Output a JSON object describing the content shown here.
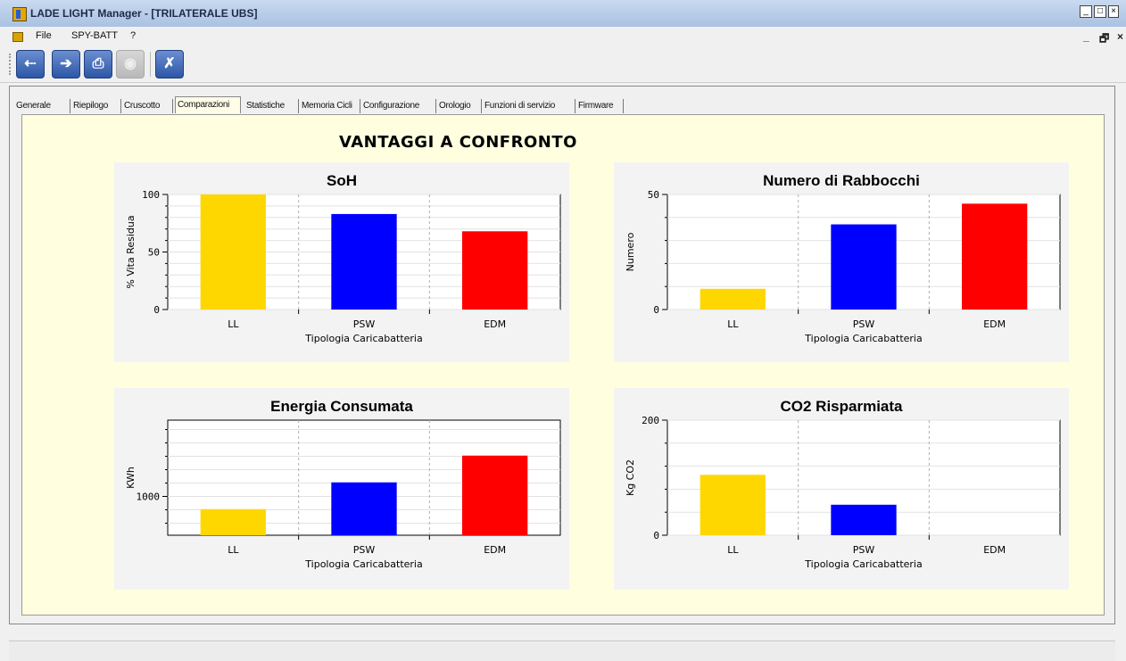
{
  "window": {
    "title": "LADE LIGHT Manager - [TRILATERALE UBS]",
    "controls": [
      "_",
      "□",
      "×"
    ],
    "mdi_controls": [
      "_",
      "🗗",
      "×"
    ]
  },
  "menu": {
    "items": [
      "File",
      "SPY-BATT",
      "?"
    ]
  },
  "toolbar": {
    "buttons": [
      {
        "icon": "usb-icon",
        "glyph": "⇠"
      },
      {
        "icon": "export-icon",
        "glyph": "➔"
      },
      {
        "icon": "print-icon",
        "glyph": "⎙"
      },
      {
        "icon": "disabled-circle-icon",
        "glyph": "◉"
      },
      {
        "icon": "close-x-icon",
        "glyph": "✗"
      }
    ]
  },
  "tabs": [
    "Generale",
    "Riepilogo",
    "Cruscotto",
    "Comparazioni",
    "Statistiche",
    "Memoria Cicli",
    "Configurazione",
    "Orologio",
    "Funzioni di servizio",
    "Firmware"
  ],
  "active_tab": "Comparazioni",
  "page": {
    "title": "VANTAGGI A CONFRONTO"
  },
  "colors": {
    "LL": "#ffd700",
    "PSW": "#0000ff",
    "EDM": "#ff0000"
  },
  "chart_data": [
    {
      "type": "bar",
      "title": "SoH",
      "xlabel": "Tipologia Caricabatteria",
      "ylabel": "% Vita Residua",
      "categories": [
        "LL",
        "PSW",
        "EDM"
      ],
      "values": [
        100,
        83,
        68
      ],
      "ylim": [
        0,
        100
      ],
      "yticks": [
        0,
        50,
        100
      ],
      "minor_step": 10,
      "grid": true
    },
    {
      "type": "bar",
      "title": "Numero di Rabbocchi",
      "xlabel": "Tipologia Caricabatteria",
      "ylabel": "Numero",
      "categories": [
        "LL",
        "PSW",
        "EDM"
      ],
      "values": [
        9,
        37,
        46
      ],
      "ylim": [
        0,
        50
      ],
      "yticks": [
        0,
        50
      ],
      "minor_step": 10,
      "grid": true
    },
    {
      "type": "bar",
      "title": "Energia Consumata",
      "xlabel": "Tipologia Caricabatteria",
      "ylabel": "KWh",
      "categories": [
        "LL",
        "PSW",
        "EDM"
      ],
      "values": [
        905,
        1105,
        1305
      ],
      "ylim": [
        710,
        1570
      ],
      "yticks": [
        1000
      ],
      "minor_step": 100,
      "grid": true
    },
    {
      "type": "bar",
      "title": "CO2 Risparmiata",
      "xlabel": "Tipologia Caricabatteria",
      "ylabel": "Kg CO2",
      "categories": [
        "LL",
        "PSW",
        "EDM"
      ],
      "values": [
        105,
        53,
        0
      ],
      "ylim": [
        0,
        200
      ],
      "yticks": [
        0,
        200
      ],
      "minor_step": 40,
      "grid": true
    }
  ]
}
